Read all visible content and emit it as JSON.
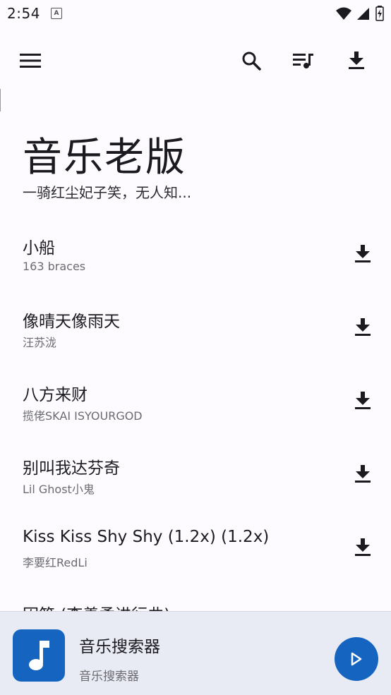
{
  "status": {
    "time": "2:54",
    "notif_glyph": "A"
  },
  "toolbar": {
    "menu_icon": "menu-icon",
    "search_icon": "search-icon",
    "queue_icon": "queue-music-icon",
    "download_icon": "download-icon"
  },
  "header": {
    "title": "音乐老版",
    "subtitle": "一骑红尘妃子笑，无人知..."
  },
  "songs": [
    {
      "title": "小船",
      "artist": "163 braces"
    },
    {
      "title": "像晴天像雨天",
      "artist": "汪苏泷"
    },
    {
      "title": "八方来财",
      "artist": "揽佬SKAI ISYOURGOD"
    },
    {
      "title": "别叫我达芬奇",
      "artist": "Lil Ghost小鬼"
    },
    {
      "title": "Kiss Kiss Shy Shy (1.2x) (1.2x)",
      "artist": "李要红RedLi"
    },
    {
      "title": "囚笼 (李善柔进行曲)",
      "artist": ""
    }
  ],
  "player": {
    "title": "音乐搜索器",
    "subtitle": "音乐搜索器",
    "accent": "#1565c0"
  }
}
